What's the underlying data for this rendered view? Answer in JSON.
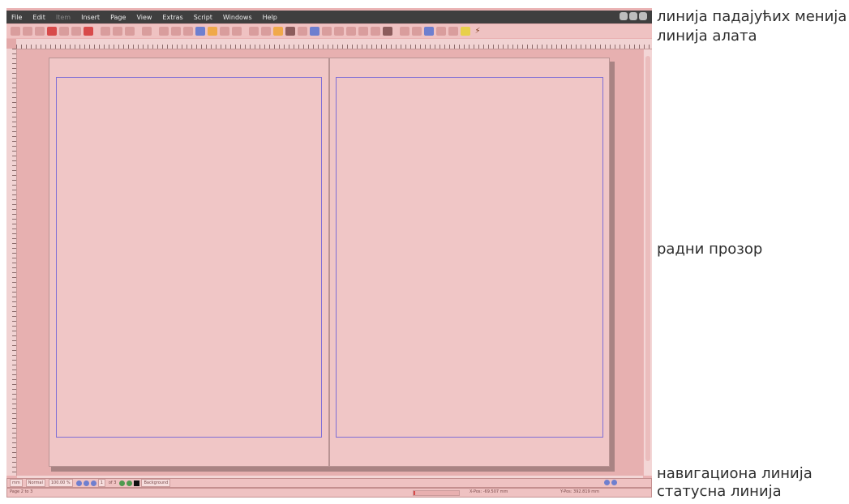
{
  "menu": [
    "File",
    "Edit",
    "Item",
    "Insert",
    "Page",
    "View",
    "Extras",
    "Script",
    "Windows",
    "Help"
  ],
  "menu_disabled_index": 2,
  "navbar": {
    "unit": "mm",
    "mode": "Normal",
    "zoom": "100.00 %",
    "page_field": "1",
    "page_of": "of 3",
    "layer": "Background"
  },
  "status": {
    "page": "Page 2 to 3",
    "x_pos": "X-Pos: -69.507 mm",
    "y_pos": "Y-Pos: 392.819 mm"
  },
  "annotations": {
    "menu_line": "линија падајућих менија",
    "toolbar_line": "линија алата",
    "work_window": "радни прозор",
    "nav_line": "навигациона линија",
    "status_line": "статусна линија"
  },
  "colors": {
    "overlay": "#eab3b4",
    "margin_guide": "#7f6ed6",
    "menubar": "#3f3f3f"
  }
}
